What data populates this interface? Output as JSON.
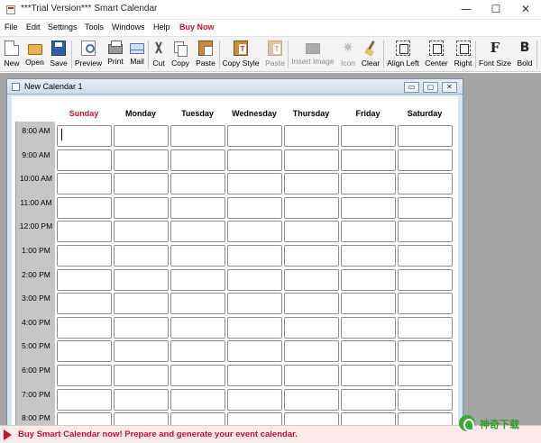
{
  "app": {
    "title": "***Trial Version*** Smart Calendar",
    "window_controls": {
      "minimize": "—",
      "maximize": "☐",
      "close": "✕"
    }
  },
  "menu": [
    "File",
    "Edit",
    "Settings",
    "Tools",
    "Windows",
    "Help",
    "Buy Now"
  ],
  "toolbar": [
    {
      "label": "New",
      "icon": "new-document-icon",
      "enabled": true
    },
    {
      "label": "Open",
      "icon": "folder-open-icon",
      "enabled": true
    },
    {
      "label": "Save",
      "icon": "floppy-save-icon",
      "enabled": true
    },
    {
      "label": "Preview",
      "icon": "print-preview-icon",
      "enabled": true
    },
    {
      "label": "Print",
      "icon": "printer-icon",
      "enabled": true
    },
    {
      "label": "Mail",
      "icon": "mail-icon",
      "enabled": true
    },
    {
      "label": "Cut",
      "icon": "scissors-icon",
      "enabled": true
    },
    {
      "label": "Copy",
      "icon": "copy-icon",
      "enabled": true
    },
    {
      "label": "Paste",
      "icon": "paste-icon",
      "enabled": true
    },
    {
      "label": "Copy Style",
      "icon": "copy-style-icon",
      "enabled": true
    },
    {
      "label": "Paste",
      "icon": "paste-style-icon",
      "enabled": false
    },
    {
      "label": "Insert Image",
      "icon": "insert-image-icon",
      "enabled": false
    },
    {
      "label": "Icon",
      "icon": "star-icon",
      "enabled": false
    },
    {
      "label": "Clear",
      "icon": "broom-icon",
      "enabled": true
    },
    {
      "label": "Align Left",
      "icon": "align-left-icon",
      "enabled": true
    },
    {
      "label": "Center",
      "icon": "align-center-icon",
      "enabled": true
    },
    {
      "label": "Right",
      "icon": "align-right-icon",
      "enabled": true
    },
    {
      "label": "Font Size",
      "icon": "font-size-icon",
      "enabled": true
    },
    {
      "label": "Bold",
      "icon": "bold-icon",
      "enabled": true
    }
  ],
  "calendar_window": {
    "title": "New Calendar 1",
    "controls": {
      "minimize": "▭",
      "maximize": "▢",
      "close": "✕"
    },
    "days": [
      "Sunday",
      "Monday",
      "Tuesday",
      "Wednesday",
      "Thursday",
      "Friday",
      "Saturday"
    ],
    "times": [
      "8:00 AM",
      "9:00 AM",
      "10:00 AM",
      "11:00 AM",
      "12:00 PM",
      "1:00 PM",
      "2:00 PM",
      "3:00 PM",
      "4:00 PM",
      "5:00 PM",
      "6:00 PM",
      "7:00 PM",
      "8:00 PM"
    ]
  },
  "promo": {
    "text": "Buy Smart Calendar now! Prepare and generate your event calendar."
  },
  "watermark": {
    "text": "神奇下载"
  },
  "colors": {
    "accent_red": "#c8102e",
    "desktop_gray": "#a5a5a5",
    "time_column": "#c6c6c6"
  }
}
